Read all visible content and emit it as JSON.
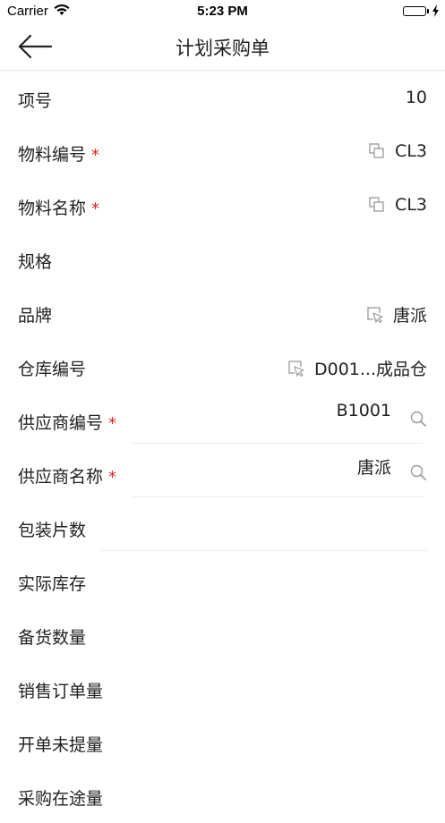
{
  "status_bar": {
    "carrier": "Carrier",
    "time": "5:23 PM"
  },
  "header": {
    "title": "计划采购单"
  },
  "rows": [
    {
      "label": "项号",
      "value": "10"
    },
    {
      "label": "物料编号",
      "value": "CL3",
      "required": true,
      "icon": "copy-icon"
    },
    {
      "label": "物料名称",
      "value": "CL3",
      "required": true,
      "icon": "copy-icon"
    },
    {
      "label": "规格",
      "value": ""
    },
    {
      "label": "品牌",
      "value": "唐派",
      "icon": "select-pointer-icon"
    },
    {
      "label": "仓库编号",
      "value": "D001...成品仓",
      "icon": "select-pointer-icon"
    },
    {
      "label": "供应商编号",
      "value": "B1001",
      "required": true,
      "icon": "search-icon"
    },
    {
      "label": "供应商名称",
      "value": "唐派",
      "required": true,
      "icon": "search-icon"
    },
    {
      "label": "包装片数",
      "value": ""
    },
    {
      "label": "实际库存",
      "value": ""
    },
    {
      "label": "备货数量",
      "value": ""
    },
    {
      "label": "销售订单量",
      "value": ""
    },
    {
      "label": "开单未提量",
      "value": ""
    },
    {
      "label": "采购在途量",
      "value": ""
    }
  ],
  "required_mark": "*",
  "colors": {
    "required": "#e02020",
    "battery": "#4cd964",
    "divider": "#ececec"
  }
}
